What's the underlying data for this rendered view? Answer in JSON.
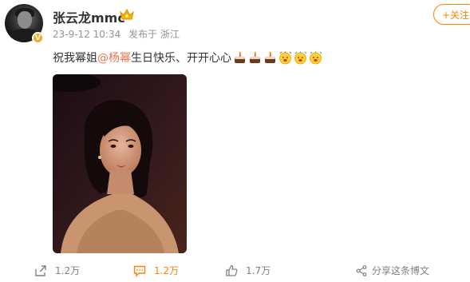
{
  "user": {
    "name": "张云龙mmc",
    "verified_badge": "V",
    "crown_icon": "vip-crown-icon"
  },
  "meta": {
    "date": "23-9-12 10:34",
    "location": "发布于 浙江"
  },
  "follow_button": "+关注",
  "post": {
    "text_before": "祝我幂姐",
    "mention": "@杨幂",
    "text_after": " 生日快乐、开开心心",
    "emojis": [
      "cake-icon",
      "cake-icon",
      "cake-icon",
      "confetti-face-icon",
      "confetti-face-icon",
      "confetti-face-icon"
    ]
  },
  "actions": {
    "share": "1.2万",
    "comment": "1.2万",
    "like": "1.7万",
    "share_post": "分享这条博文"
  },
  "colors": {
    "accent": "#ff8200",
    "mention": "#eb7350",
    "meta_text": "#939393"
  }
}
